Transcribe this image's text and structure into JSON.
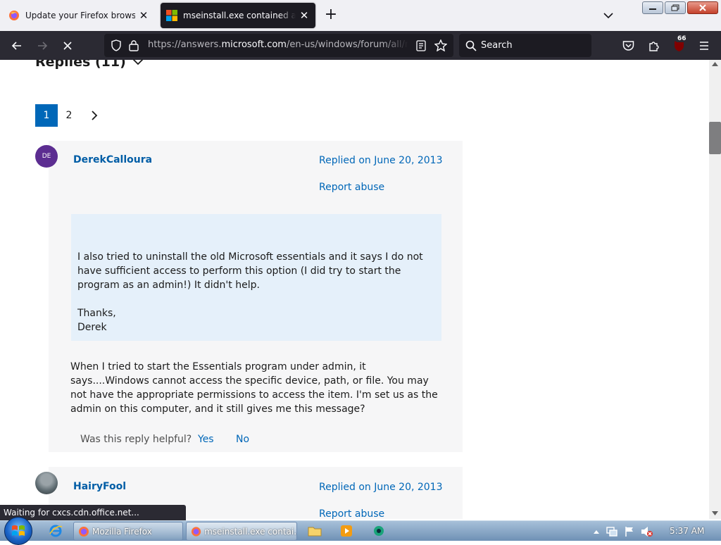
{
  "tabs": [
    {
      "label": "Update your Firefox browser",
      "icon": "firefox-icon",
      "active": false
    },
    {
      "label": "mseinstall.exe contained a virus",
      "icon": "microsoft-logo-icon",
      "active": true
    }
  ],
  "navbar": {
    "url_prefix": "https://answers.",
    "url_domain": "microsoft.com",
    "url_path": "/en-us/windows/forum/all/mseinstall-exe",
    "search_placeholder": "Search",
    "extension_badge": "66"
  },
  "page": {
    "replies_heading": "Replies (11)",
    "pages": [
      "1",
      "2"
    ],
    "active_page": "1"
  },
  "replies": [
    {
      "avatar_initials": "DE",
      "author": "DerekCalloura",
      "replied": "Replied on June 20, 2013",
      "report": "Report abuse",
      "quote_line1": "I also tried to uninstall the old Microsoft essentials and it says I do not have sufficient access to perform this option (I did try to start the program as an admin!)  It didn't help.",
      "quote_line2": "Thanks,",
      "quote_line3": "Derek",
      "body": "When I tried to start the Essentials program under admin, it says....Windows cannot access the specific device, path, or file.  You may not have the appropriate permissions to access the item.  I'm set us as the admin on this computer, and it still gives me this message?",
      "helpful_question": "Was this reply helpful?",
      "yes": "Yes",
      "no": "No"
    },
    {
      "author": "HairyFool",
      "replied": "Replied on June 20, 2013",
      "report": "Report abuse"
    }
  ],
  "status_text": "Waiting for cxcs.cdn.office.net...",
  "taskbar": {
    "tasks": [
      "Mozilla Firefox",
      "mseinstall.exe contai..."
    ],
    "clock": "5:37 AM"
  },
  "colors": {
    "link": "#0067b8",
    "active_page": "#0067b8",
    "quote_bg": "#e5f0fa",
    "avatar": "#5c2d91"
  }
}
